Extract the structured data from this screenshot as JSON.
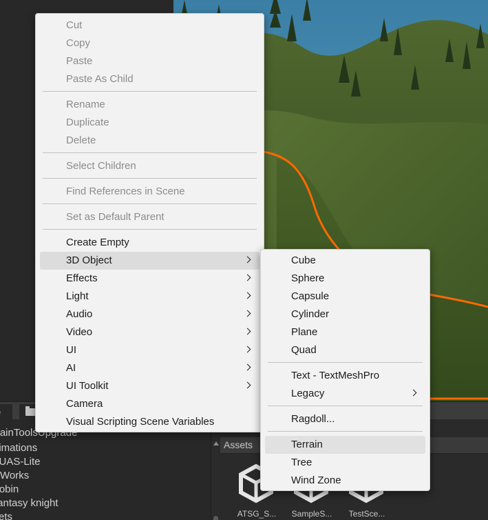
{
  "context_menu": {
    "items": [
      {
        "label": "Cut",
        "enabled": false
      },
      {
        "label": "Copy",
        "enabled": false
      },
      {
        "label": "Paste",
        "enabled": false
      },
      {
        "label": "Paste As Child",
        "enabled": false
      },
      {
        "label": "Rename",
        "enabled": false
      },
      {
        "label": "Duplicate",
        "enabled": false
      },
      {
        "label": "Delete",
        "enabled": false
      },
      {
        "label": "Select Children",
        "enabled": false
      },
      {
        "label": "Find References in Scene",
        "enabled": false
      },
      {
        "label": "Set as Default Parent",
        "enabled": false
      },
      {
        "label": "Create Empty",
        "enabled": true
      },
      {
        "label": "3D Object",
        "enabled": true,
        "submenu": true,
        "highlighted": true
      },
      {
        "label": "Effects",
        "enabled": true,
        "submenu": true
      },
      {
        "label": "Light",
        "enabled": true,
        "submenu": true
      },
      {
        "label": "Audio",
        "enabled": true,
        "submenu": true
      },
      {
        "label": "Video",
        "enabled": true,
        "submenu": true
      },
      {
        "label": "UI",
        "enabled": true,
        "submenu": true
      },
      {
        "label": "AI",
        "enabled": true,
        "submenu": true
      },
      {
        "label": "UI Toolkit",
        "enabled": true,
        "submenu": true
      },
      {
        "label": "Camera",
        "enabled": true
      },
      {
        "label": "Visual Scripting Scene Variables",
        "enabled": true
      }
    ]
  },
  "submenu_3d_object": {
    "items": [
      {
        "label": "Cube"
      },
      {
        "label": "Sphere"
      },
      {
        "label": "Capsule"
      },
      {
        "label": "Cylinder"
      },
      {
        "label": "Plane"
      },
      {
        "label": "Quad"
      },
      {
        "label": "Text - TextMeshPro"
      },
      {
        "label": "Legacy",
        "submenu": true
      },
      {
        "label": "Ragdoll..."
      },
      {
        "label": "Terrain",
        "highlighted": true
      },
      {
        "label": "Tree"
      },
      {
        "label": "Wind Zone"
      }
    ]
  },
  "project": {
    "tab_left_label": "e",
    "tree_items": [
      "TerrainToolsUpgrade",
      "Animations",
      "JUAS-Lite",
      "Works",
      "Robin",
      "Fantasy knight",
      "Sets"
    ],
    "assets_label": "Assets",
    "assets": [
      "ATSG_S...",
      "SampleS...",
      "TestSce..."
    ]
  },
  "icons": {
    "submenu_arrow": "chevron-right-icon",
    "project_tab": "folder-icon",
    "asset": "unity-cube-icon",
    "scroll_up": "scroll-up-arrow-icon"
  },
  "colors": {
    "menu_bg": "#f2f2f2",
    "menu_highlight": "#dcdcdc",
    "disabled_text": "#8c8c8c",
    "editor_bg": "#282828",
    "terrain_outline": "#ff6a00"
  }
}
